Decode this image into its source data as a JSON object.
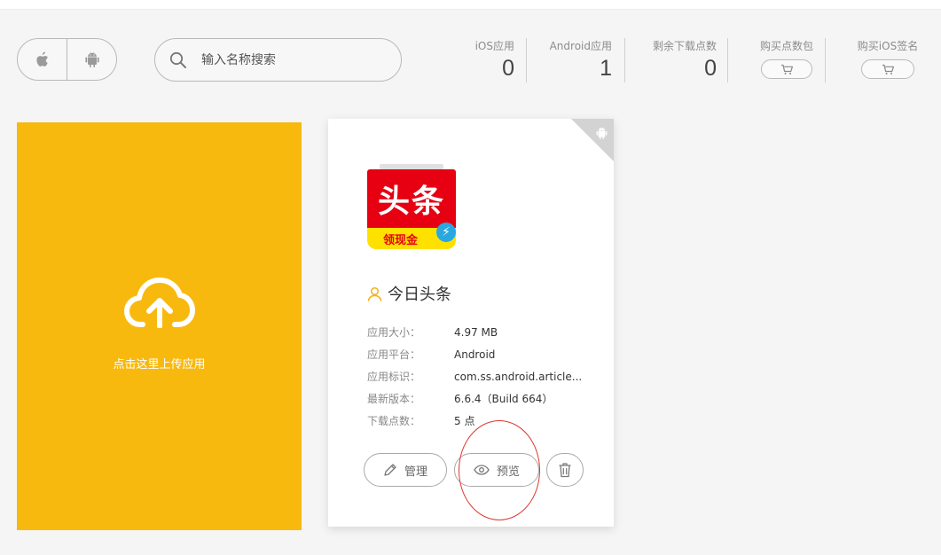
{
  "platform_toggle": {
    "ios_icon": "apple-icon",
    "android_icon": "android-icon"
  },
  "search": {
    "placeholder": "输入名称搜索",
    "value": "",
    "icon": "search-icon"
  },
  "stats": [
    {
      "label": "iOS应用",
      "value": "0"
    },
    {
      "label": "Android应用",
      "value": "1"
    },
    {
      "label": "剩余下载点数",
      "value": "0"
    }
  ],
  "buy": [
    {
      "label": "购买点数包",
      "icon": "cart-icon"
    },
    {
      "label": "购买iOS签名",
      "icon": "cart-icon"
    }
  ],
  "upload": {
    "label": "点击这里上传应用",
    "icon": "cloud-upload-icon"
  },
  "app": {
    "name": "今日头条",
    "logo_text": "头条",
    "logo_subtext": "领现金",
    "platform_badge_icon": "android-icon",
    "info": [
      {
        "key": "应用大小：",
        "value": "4.97 MB"
      },
      {
        "key": "应用平台：",
        "value": "Android"
      },
      {
        "key": "应用标识：",
        "value": "com.ss.android.article..."
      },
      {
        "key": "最新版本：",
        "value": "6.6.4（Build 664）"
      },
      {
        "key": "下载点数：",
        "value": "5 点"
      }
    ],
    "actions": {
      "manage": "管理",
      "preview": "预览"
    }
  },
  "colors": {
    "upload_bg": "#f8b90f",
    "annotation": "#e0362c",
    "logo_red": "#e60012",
    "logo_yellow": "#ffe100"
  }
}
